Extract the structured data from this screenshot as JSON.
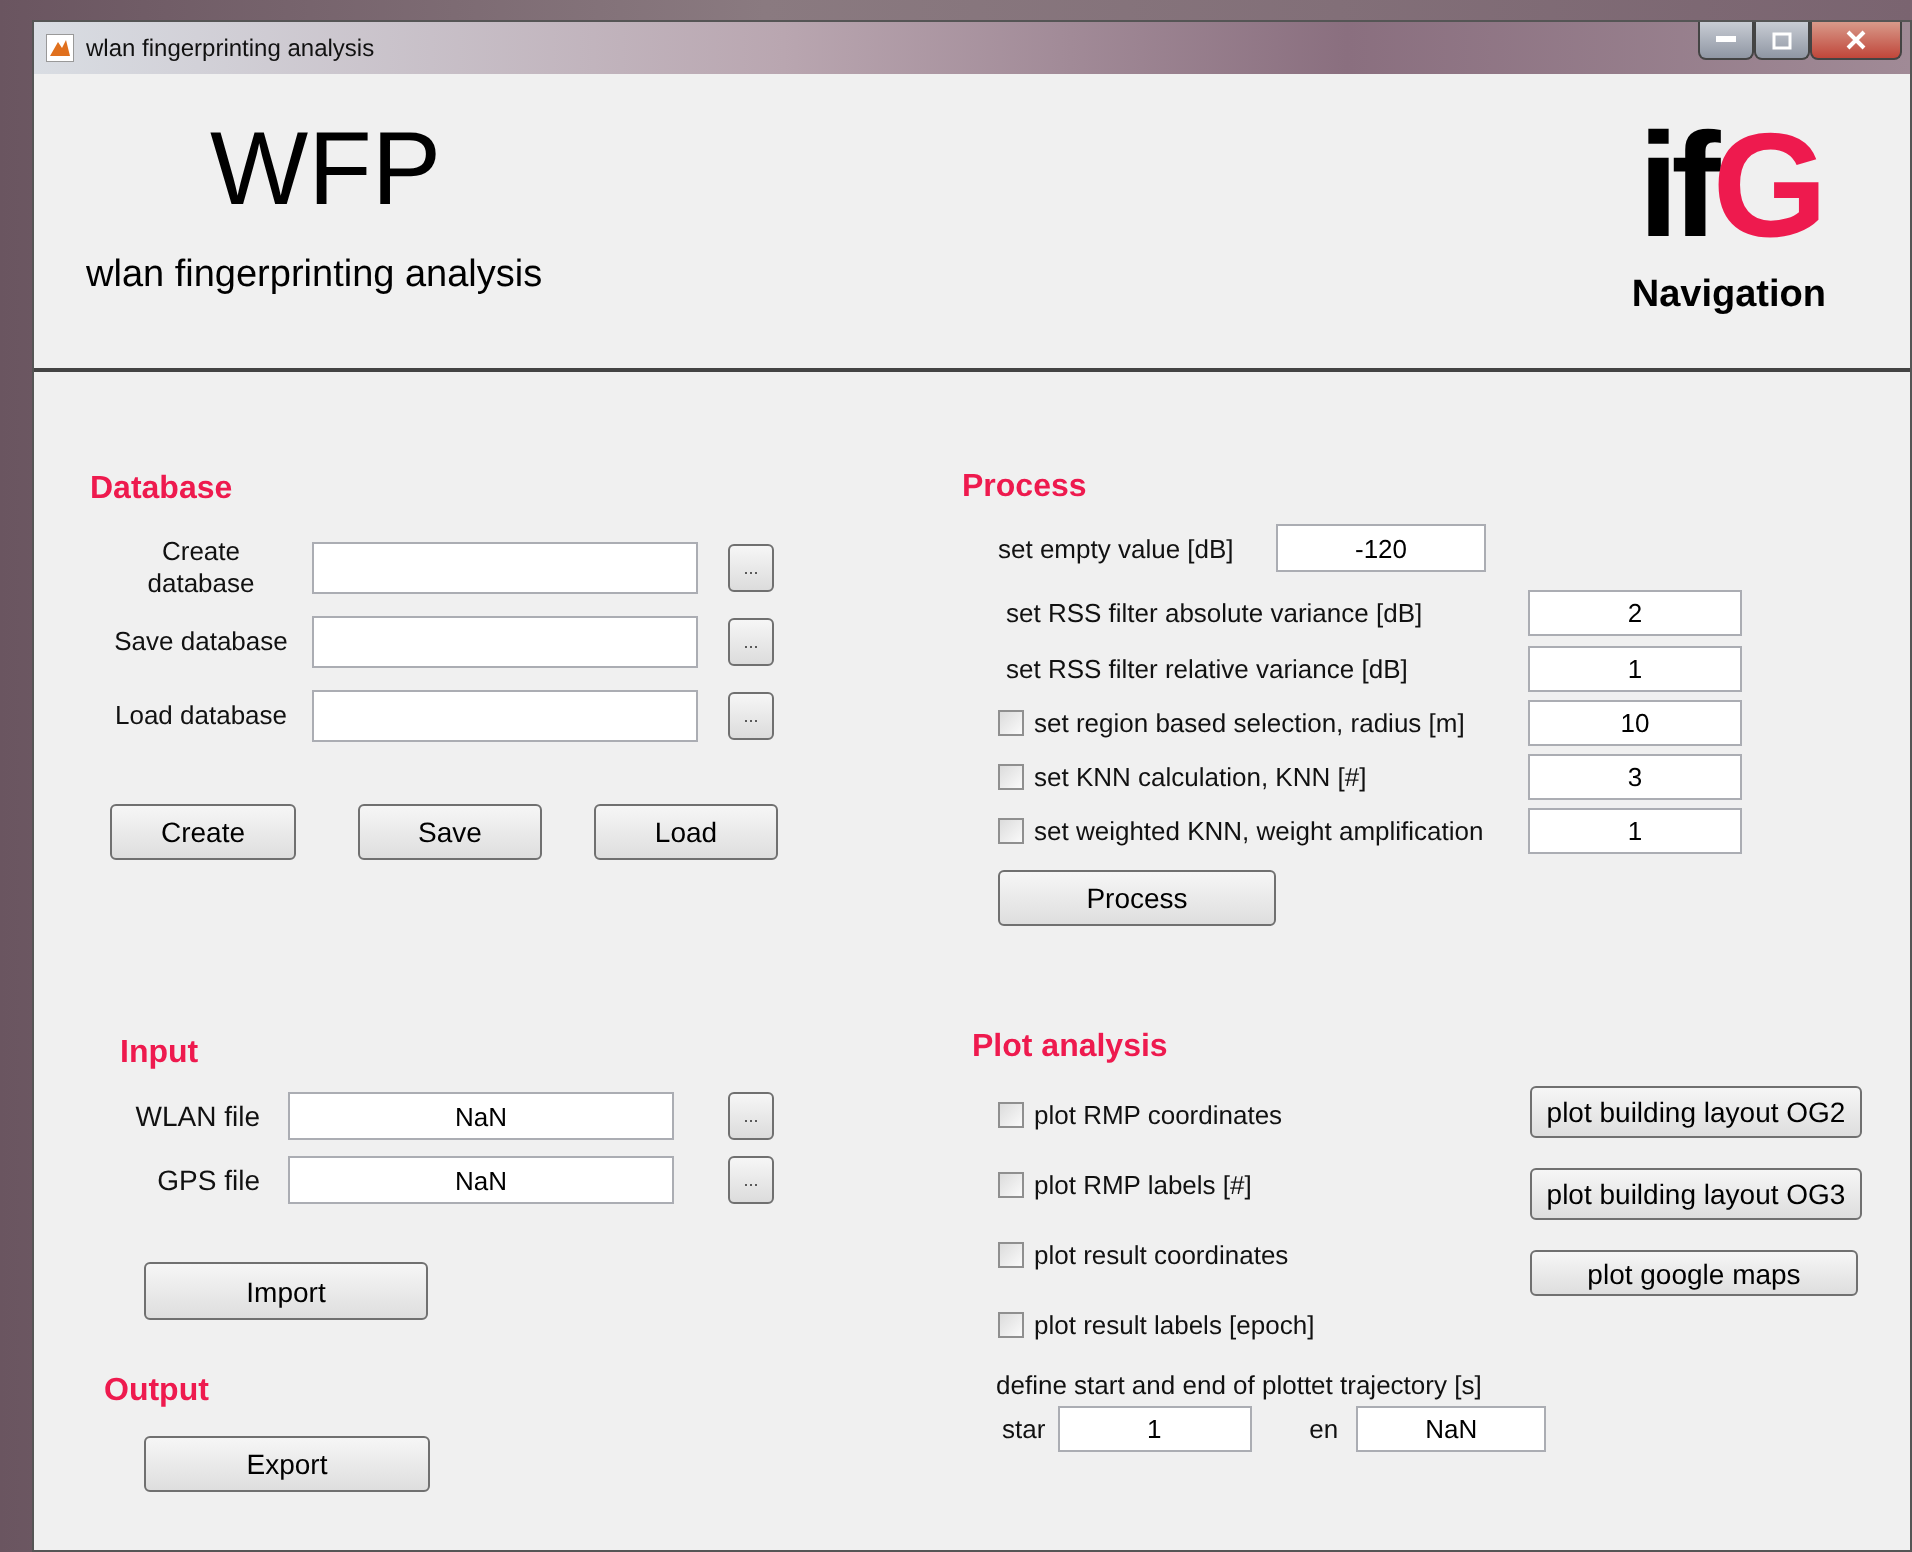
{
  "window": {
    "title": "wlan fingerprinting analysis"
  },
  "header": {
    "title": "WFP",
    "subtitle": "wlan fingerprinting analysis",
    "logo_letters": "ifG",
    "logo_caption": "Navigation"
  },
  "database": {
    "heading": "Database",
    "rows": [
      {
        "label": "Create database",
        "browse": "..."
      },
      {
        "label": "Save database",
        "browse": "..."
      },
      {
        "label": "Load database",
        "browse": "..."
      }
    ],
    "buttons": [
      "Create",
      "Save",
      "Load"
    ]
  },
  "input": {
    "heading": "Input",
    "rows": [
      {
        "label": "WLAN file",
        "value": "NaN",
        "browse": "..."
      },
      {
        "label": "GPS file",
        "value": "NaN",
        "browse": "..."
      }
    ],
    "button": "Import"
  },
  "output": {
    "heading": "Output",
    "button": "Export"
  },
  "process": {
    "heading": "Process",
    "rows": [
      {
        "kind": "inline",
        "label": "set empty value [dB]",
        "value": "-120"
      },
      {
        "kind": "field",
        "label": "set RSS filter absolute variance [dB]",
        "value": "2"
      },
      {
        "kind": "field",
        "label": "set RSS filter relative variance [dB]",
        "value": "1"
      },
      {
        "kind": "checkbox",
        "label": "set region based selection, radius [m]",
        "value": "10",
        "checked": false
      },
      {
        "kind": "checkbox",
        "label": "set KNN calculation, KNN [#]",
        "value": "3",
        "checked": false
      },
      {
        "kind": "checkbox",
        "label": "set weighted KNN, weight amplification",
        "value": "1",
        "checked": false
      }
    ],
    "button": "Process"
  },
  "plot_analysis": {
    "heading": "Plot analysis",
    "options": [
      {
        "label": "plot RMP coordinates",
        "checked": false
      },
      {
        "label": "plot RMP labels [#]",
        "checked": false
      },
      {
        "label": "plot result coordinates",
        "checked": false
      },
      {
        "label": "plot result labels [epoch]",
        "checked": false
      }
    ],
    "buttons": [
      "plot building layout OG2",
      "plot building layout OG3",
      "plot google maps"
    ],
    "range": {
      "label": "define start and end of plottet trajectory [s]",
      "start_label": "star",
      "start_value": "1",
      "end_label": "en",
      "end_value": "NaN"
    }
  }
}
